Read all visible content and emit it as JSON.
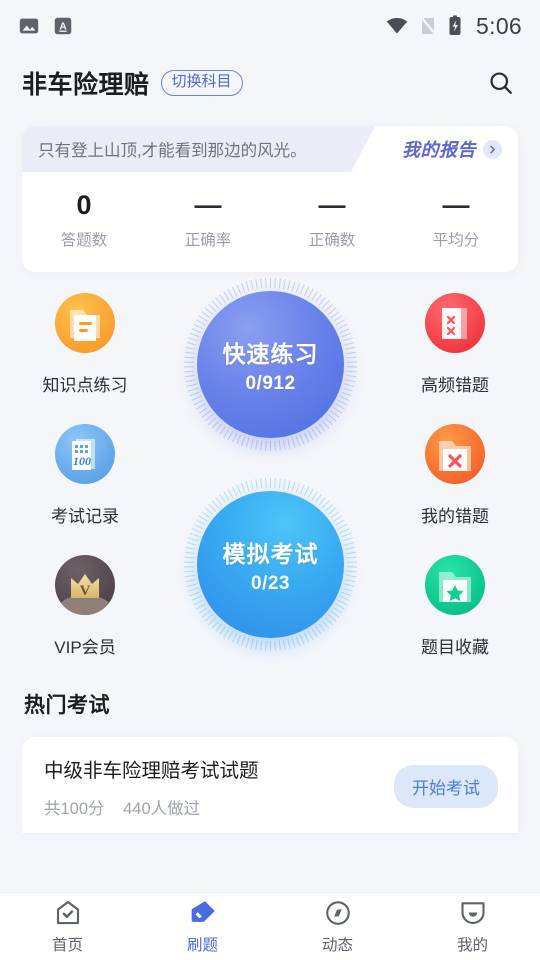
{
  "statusbar": {
    "time": "5:06",
    "icons": [
      "image-icon",
      "font-a-icon",
      "wifi-icon",
      "sim-off-icon",
      "battery-charging-icon"
    ]
  },
  "header": {
    "title": "非车险理赔",
    "switch_subject_label": "切换科目",
    "search_icon": "search-icon"
  },
  "stats_card": {
    "quote": "只有登上山顶,才能看到那边的风光。",
    "report_label": "我的报告",
    "chevron_icon": "chevron-right-icon",
    "stats": [
      {
        "value": "0",
        "label": "答题数"
      },
      {
        "value": "—",
        "label": "正确率"
      },
      {
        "value": "—",
        "label": "正确数"
      },
      {
        "value": "—",
        "label": "平均分"
      }
    ]
  },
  "features": {
    "side_items": [
      {
        "label": "知识点练习",
        "icon": "folder-document-icon",
        "color": "#faa13a"
      },
      {
        "label": "高频错题",
        "icon": "notebook-x-icon",
        "color": "#f9454c"
      },
      {
        "label": "考试记录",
        "icon": "score-paper-icon",
        "color": "#6cb0ef"
      },
      {
        "label": "我的错题",
        "icon": "folder-x-icon",
        "color": "#f97836"
      },
      {
        "label": "VIP会员",
        "icon": "crown-icon",
        "color": "#5c5158"
      },
      {
        "label": "题目收藏",
        "icon": "folder-star-icon",
        "color": "#10cf93"
      }
    ],
    "circles": [
      {
        "title": "快速练习",
        "progress": "0/912",
        "color": "#5a75e6"
      },
      {
        "title": "模拟考试",
        "progress": "0/23",
        "color": "#33a3f0"
      }
    ]
  },
  "hot_exams": {
    "section_title": "热门考试",
    "items": [
      {
        "name": "中级非车险理赔考试试题",
        "score_text": "共100分",
        "takers_text": "440人做过",
        "action_label": "开始考试"
      }
    ]
  },
  "bottomnav": {
    "items": [
      {
        "label": "首页",
        "icon": "home-check-icon",
        "active": false
      },
      {
        "label": "刷题",
        "icon": "tag-pen-icon",
        "active": true
      },
      {
        "label": "动态",
        "icon": "compass-icon",
        "active": false
      },
      {
        "label": "我的",
        "icon": "profile-icon",
        "active": false
      }
    ]
  }
}
